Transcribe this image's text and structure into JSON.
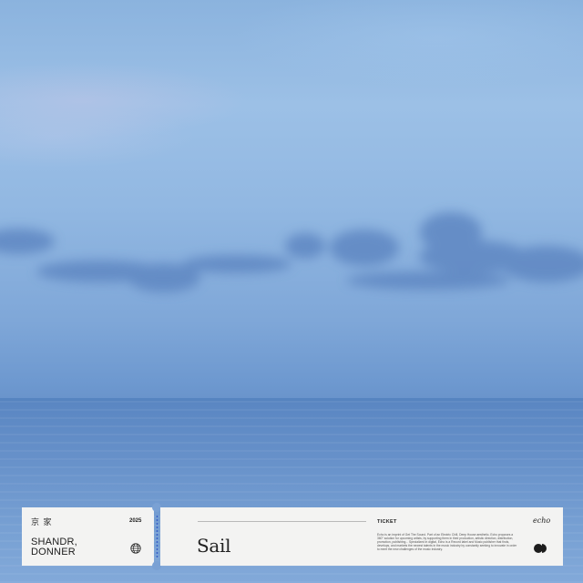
{
  "ticket": {
    "kanji": "京 家",
    "year": "2025",
    "artist_line1": "SHANDR,",
    "artist_line2": "DONNER",
    "label": "TICKET",
    "title": "Sail",
    "brand": "echo",
    "description": "Echo is an imprint of Get The Sound. Part of an Electric Chill, Deep House aesthetic, Echo proposes a 360° solution for upcoming artists, by supporting them in their production, artistic direction, distribution, promotion, publishing... Specialized in digital, Echo is a Record label and Music publisher that finds, develops, and markets the newest talents in the music industry by constantly seeking to innovate in order to meet the new challenges of the music industry."
  },
  "icons": {
    "globe": "globe-icon",
    "logo": "echo-logo-icon"
  },
  "colors": {
    "ticket_bg": "#f3f3f2",
    "perforation": "#3b63c8",
    "sky": "#9cc0e6",
    "sea": "#5a86c2"
  }
}
